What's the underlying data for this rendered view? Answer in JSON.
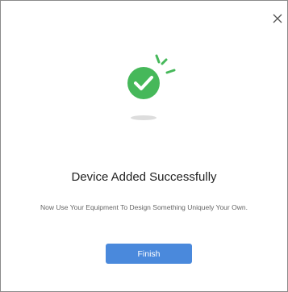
{
  "dialog": {
    "title": "Device Added Successfully",
    "message": "Now Use Your Equipment To Design Something Uniquely Your Own.",
    "finish_label": "Finish",
    "close_icon": "close-icon",
    "success_icon": "check-circle-icon"
  },
  "colors": {
    "success_green": "#46b85a",
    "primary_button": "#4a89dc",
    "close_icon": "#555555",
    "shadow": "#dddddd"
  }
}
